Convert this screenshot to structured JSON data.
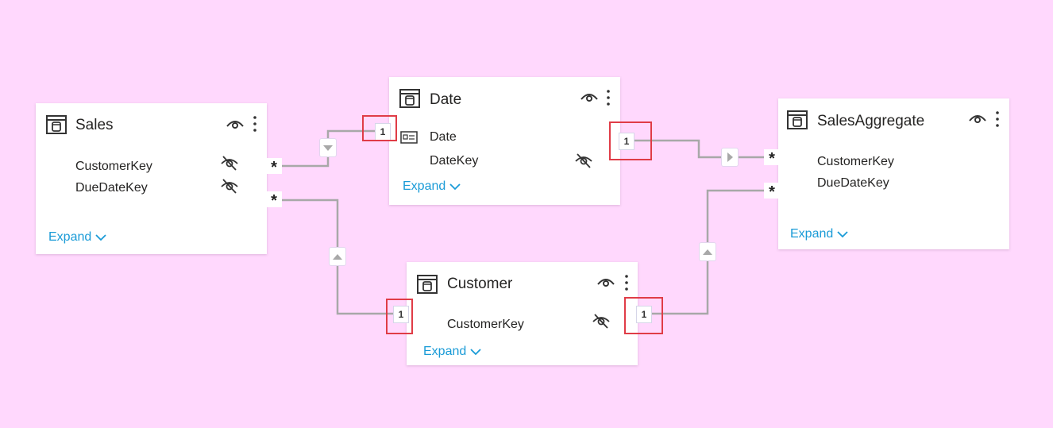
{
  "tables": {
    "sales": {
      "name": "Sales",
      "fields": [
        "CustomerKey",
        "DueDateKey"
      ],
      "expand": "Expand"
    },
    "date": {
      "name": "Date",
      "fields": [
        "Date",
        "DateKey"
      ],
      "expand": "Expand"
    },
    "customer": {
      "name": "Customer",
      "fields": [
        "CustomerKey"
      ],
      "expand": "Expand"
    },
    "salesaggregate": {
      "name": "SalesAggregate",
      "fields": [
        "CustomerKey",
        "DueDateKey"
      ],
      "expand": "Expand"
    }
  },
  "relationships": [
    {
      "from": "Sales",
      "to": "Date",
      "from_cardinality": "*",
      "to_cardinality": "1",
      "filter_direction": "single"
    },
    {
      "from": "Sales",
      "to": "Customer",
      "from_cardinality": "*",
      "to_cardinality": "1",
      "filter_direction": "single"
    },
    {
      "from": "SalesAggregate",
      "to": "Date",
      "from_cardinality": "*",
      "to_cardinality": "1",
      "filter_direction": "single"
    },
    {
      "from": "SalesAggregate",
      "to": "Customer",
      "from_cardinality": "*",
      "to_cardinality": "1",
      "filter_direction": "single"
    }
  ],
  "cardinality": {
    "one": "1",
    "many": "*"
  },
  "colors": {
    "background": "#ffd8fd",
    "link": "#1a9bd7",
    "highlight": "#e03c47",
    "wire": "#9a9a9a"
  }
}
